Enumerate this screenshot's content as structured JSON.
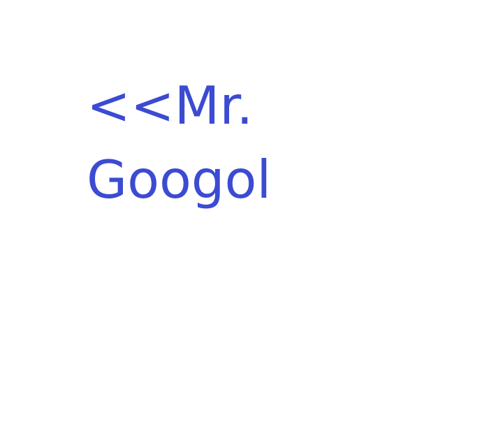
{
  "text": {
    "line1": "<<Mr.",
    "line2": "Googol"
  },
  "colors": {
    "background": "#ffffff",
    "text": "#3b4bd2"
  }
}
